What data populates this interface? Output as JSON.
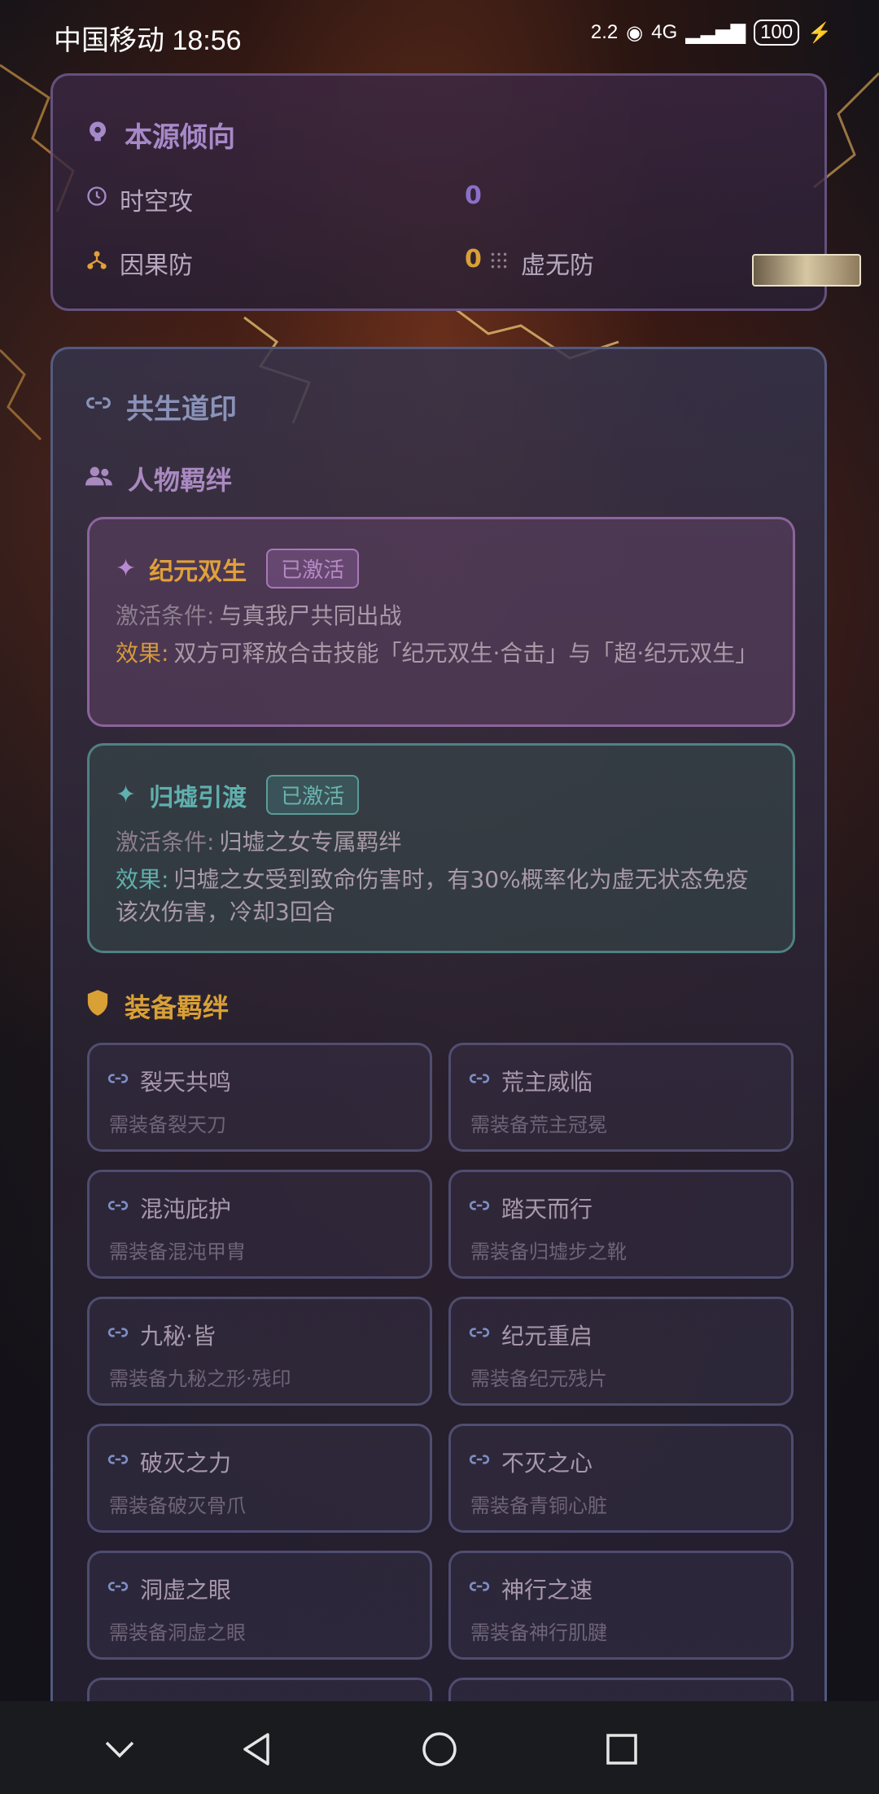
{
  "status": {
    "carrier_time": "中国移动 18:56",
    "speed": "2.2",
    "network": "4G",
    "battery": "100"
  },
  "origin": {
    "title": "本源倾向",
    "stats": [
      {
        "label": "时空攻",
        "value": "0",
        "color": "#8a70c8"
      },
      {
        "label": "因果防",
        "value": "0",
        "color": "#d9a036"
      },
      {
        "label": "虚无防"
      }
    ]
  },
  "symbiosis": {
    "title": "共生道印",
    "character_bonds_title": "人物羁绊",
    "bonds": [
      {
        "name": "纪元双生",
        "status": "已激活",
        "condition_key": "激活条件:",
        "condition": "与真我尸共同出战",
        "effect_key": "效果:",
        "effect": "双方可释放合击技能「纪元双生·合击」与「超·纪元双生」",
        "accent": "#e0a03a"
      },
      {
        "name": "归墟引渡",
        "status": "已激活",
        "condition_key": "激活条件:",
        "condition": "归墟之女专属羁绊",
        "effect_key": "效果:",
        "effect": "归墟之女受到致命伤害时，有30%概率化为虚无状态免疫该次伤害，冷却3回合",
        "accent": "#5fb0ae"
      }
    ],
    "equipment_bonds_title": "装备羁绊",
    "equipment": [
      {
        "name": "裂天共鸣",
        "req": "需装备裂天刀"
      },
      {
        "name": "荒主威临",
        "req": "需装备荒主冠冕"
      },
      {
        "name": "混沌庇护",
        "req": "需装备混沌甲胄"
      },
      {
        "name": "踏天而行",
        "req": "需装备归墟步之靴"
      },
      {
        "name": "九秘·皆",
        "req": "需装备九秘之形·残印"
      },
      {
        "name": "纪元重启",
        "req": "需装备纪元残片"
      },
      {
        "name": "破灭之力",
        "req": "需装备破灭骨爪"
      },
      {
        "name": "不灭之心",
        "req": "需装备青铜心脏"
      },
      {
        "name": "洞虚之眼",
        "req": "需装备洞虚之眼"
      },
      {
        "name": "神行之速",
        "req": "需装备神行肌腱"
      }
    ]
  }
}
